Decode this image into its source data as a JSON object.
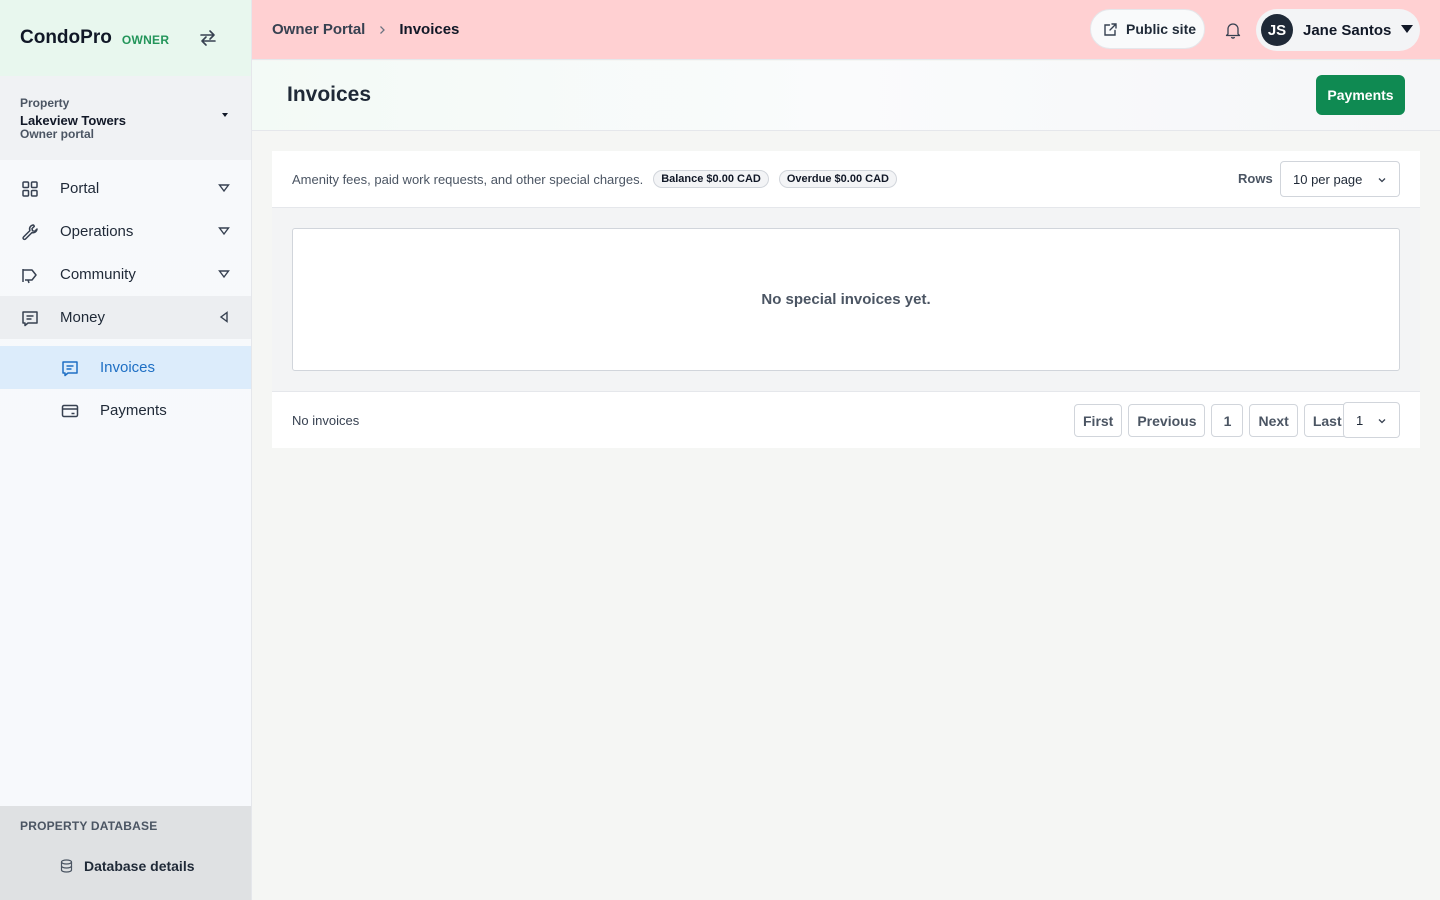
{
  "brand": {
    "name": "CondoPro",
    "role": "OWNER"
  },
  "property": {
    "label": "Property",
    "name": "Lakeview Towers",
    "subtitle": "Owner portal"
  },
  "nav": {
    "items": [
      {
        "label": "Portal",
        "icon": "grid-icon"
      },
      {
        "label": "Operations",
        "icon": "wrench-icon"
      },
      {
        "label": "Community",
        "icon": "megaphone-icon"
      },
      {
        "label": "Money",
        "icon": "receipt-icon"
      }
    ],
    "money_sub": [
      {
        "label": "Invoices",
        "icon": "invoice-icon",
        "active": true
      },
      {
        "label": "Payments",
        "icon": "card-icon",
        "active": false
      }
    ]
  },
  "db": {
    "title": "PROPERTY DATABASE",
    "link": "Database details"
  },
  "topbar": {
    "breadcrumb_root": "Owner Portal",
    "breadcrumb_current": "Invoices",
    "public_site": "Public site",
    "user_initials": "JS",
    "user_name": "Jane Santos"
  },
  "page": {
    "title": "Invoices",
    "payments_button": "Payments"
  },
  "card": {
    "description": "Amenity fees, paid work requests, and other special charges.",
    "balance_badge": "Balance $0.00 CAD",
    "overdue_badge": "Overdue $0.00 CAD",
    "rows_label": "Rows",
    "rows_value": "10 per page",
    "empty_text": "No special invoices yet.",
    "count_text": "No invoices",
    "pager": {
      "first": "First",
      "previous": "Previous",
      "page": "1",
      "next": "Next",
      "last": "Last",
      "page_select": "1"
    }
  },
  "colors": {
    "accent": "#0f8a52",
    "topbar": "#ffd0d2",
    "active_nav": "#dcecfb",
    "active_text": "#1e6fc4"
  }
}
